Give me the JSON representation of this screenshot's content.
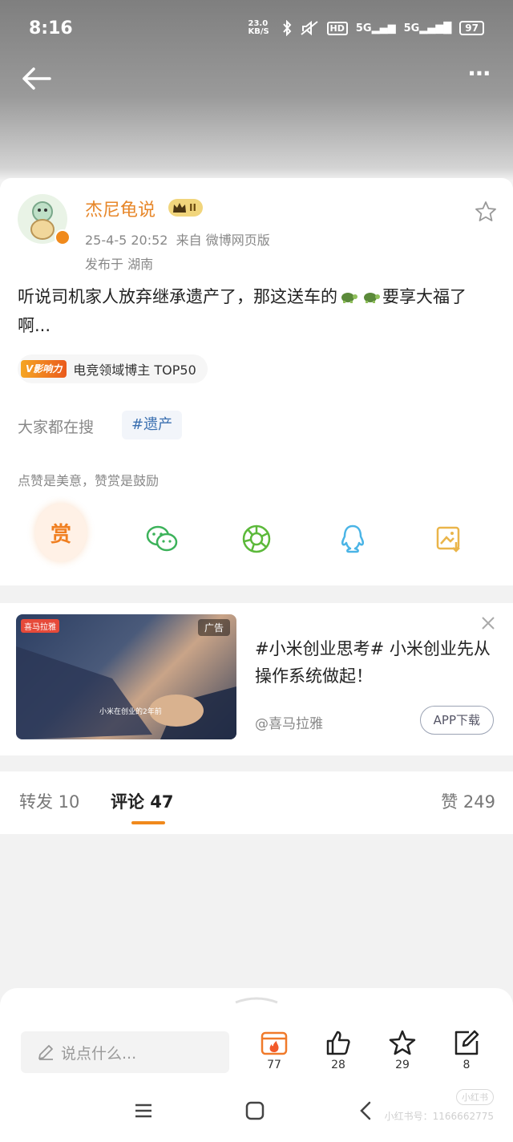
{
  "status_bar": {
    "time": "8:16",
    "network_speed": "23.0 KB/S",
    "network_1": "5G",
    "network_2": "5G",
    "hd_label": "HD",
    "battery": "97"
  },
  "nav": {
    "back_icon": "arrow-left-icon",
    "more_label": "⋯"
  },
  "post": {
    "author": "杰尼龟说",
    "vip_level": "II",
    "meta": "25-4-5 20:52  来自 微博网页版",
    "location": "发布于 湖南",
    "text_part1": "听说司机家人放弃继承遗产了，那这送车的",
    "text_part2": "要享大福了啊...",
    "influence_badge": "V影响力",
    "influence_text": "电竞领域博主 TOP50",
    "search_label": "大家都在搜",
    "search_tag": "#遗产",
    "tip": "点赞是美意，赞赏是鼓励",
    "reward_label": "赏"
  },
  "share": [
    "wechat-icon",
    "moments-icon",
    "qq-icon",
    "save-image-icon"
  ],
  "ad": {
    "tag": "广告",
    "source_logo": "喜马拉雅",
    "caption": "小米在创业的2年前",
    "title": "#小米创业思考# 小米创业先从操作系统做起！",
    "source": "@喜马拉雅",
    "download_label": "APP下载"
  },
  "tabs": {
    "repost": "转发 10",
    "comment": "评论 47",
    "like": "赞 249"
  },
  "bottom": {
    "placeholder": "说点什么...",
    "actions": [
      {
        "icon": "calendar-fire-icon",
        "count": "77"
      },
      {
        "icon": "thumbs-up-icon",
        "count": "28"
      },
      {
        "icon": "star-icon",
        "count": "29"
      },
      {
        "icon": "edit-icon",
        "count": "8"
      }
    ],
    "watermark_top": "小红书",
    "watermark": "小红书号：1166662775"
  },
  "colors": {
    "accent": "#f0891c",
    "username": "#e7872a",
    "link": "#3a6fb0"
  }
}
